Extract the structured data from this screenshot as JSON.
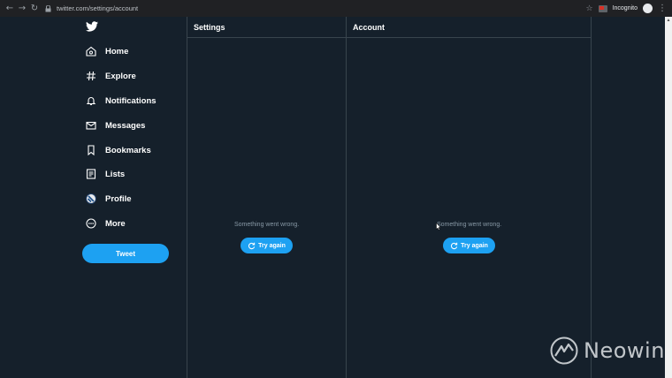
{
  "browser": {
    "url": "twitter.com/settings/account",
    "profile_label": "Incognito"
  },
  "sidebar": {
    "items": [
      {
        "label": "Home",
        "icon": "home-icon"
      },
      {
        "label": "Explore",
        "icon": "hashtag-icon"
      },
      {
        "label": "Notifications",
        "icon": "bell-icon"
      },
      {
        "label": "Messages",
        "icon": "envelope-icon"
      },
      {
        "label": "Bookmarks",
        "icon": "bookmark-icon"
      },
      {
        "label": "Lists",
        "icon": "list-icon"
      },
      {
        "label": "Profile",
        "icon": "avatar-icon"
      },
      {
        "label": "More",
        "icon": "more-icon"
      }
    ],
    "tweet_label": "Tweet"
  },
  "settings_column": {
    "title": "Settings",
    "error_text": "Something went wrong.",
    "retry_label": "Try again"
  },
  "account_column": {
    "title": "Account",
    "error_text": "Something went wrong.",
    "retry_label": "Try again"
  },
  "watermark": {
    "text": "Neowin"
  },
  "colors": {
    "background": "#15202b",
    "accent": "#1da1f2",
    "border": "#38444d",
    "muted_text": "#8899a6"
  }
}
